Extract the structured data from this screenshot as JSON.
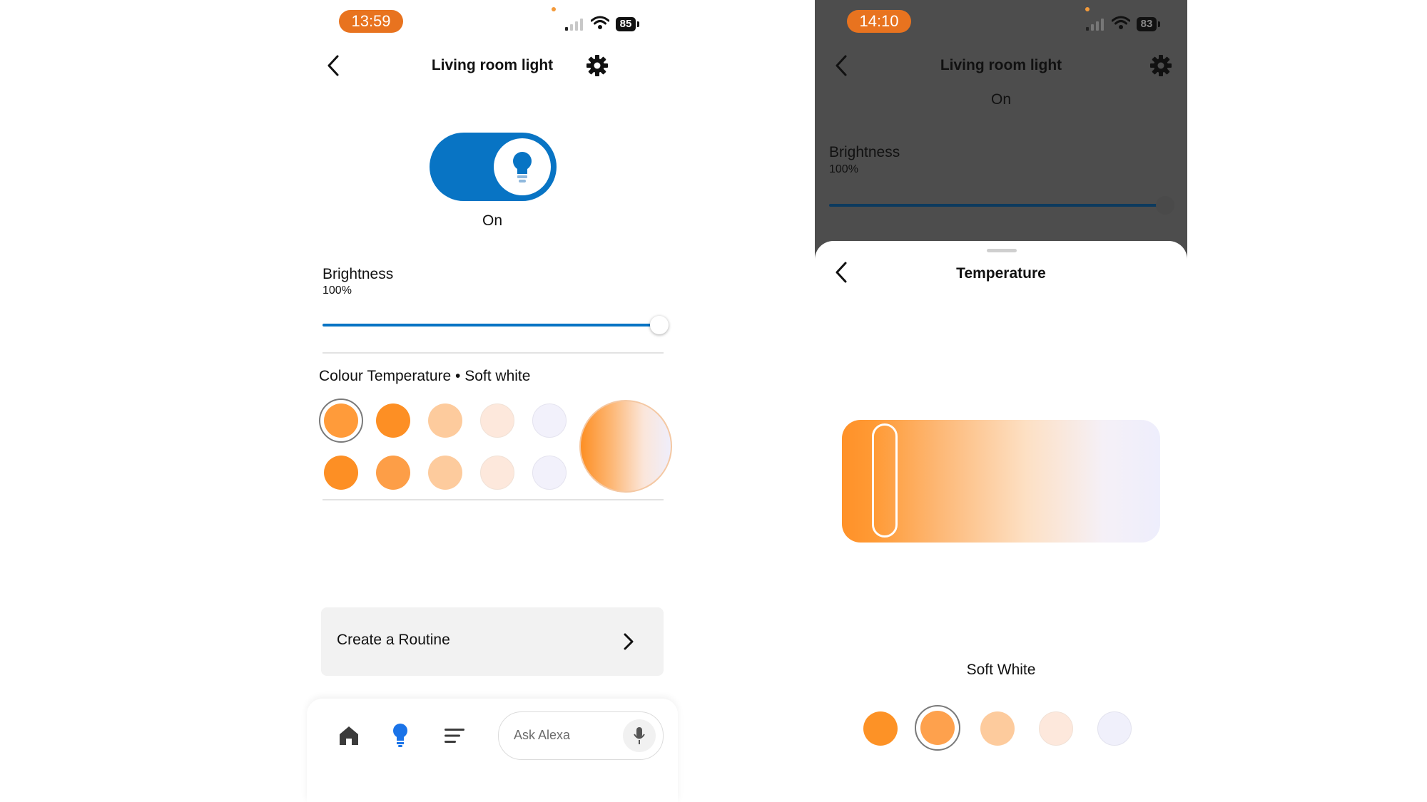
{
  "left_screen": {
    "status_bar": {
      "time": "13:59",
      "battery": "85"
    },
    "header": {
      "title": "Living room light"
    },
    "power": {
      "state_label": "On"
    },
    "brightness": {
      "label": "Brightness",
      "value": "100%",
      "level_percent": 100
    },
    "colour_temperature": {
      "label": "Colour Temperature • Soft white",
      "swatches_row1": [
        "#ff9b3a",
        "#fd8f24",
        "#fdcb9d",
        "#fde8dc",
        "#f2f1fb"
      ],
      "swatches_row2": [
        "#fd8f24",
        "#fd9e47",
        "#fdcb9d",
        "#fde8dc",
        "#f2f1fb"
      ],
      "selected_index": 0
    },
    "routine": {
      "label": "Create a Routine"
    },
    "bottom_nav": {
      "ask_placeholder": "Ask Alexa"
    },
    "colors": {
      "accent": "#0874c4",
      "time_pill": "#e8731f"
    }
  },
  "right_screen": {
    "status_bar": {
      "time": "14:10",
      "battery": "83"
    },
    "header": {
      "title": "Living room light",
      "state_label": "On"
    },
    "brightness": {
      "label": "Brightness",
      "value": "100%",
      "level_percent": 100
    },
    "sheet": {
      "title": "Temperature",
      "selection_label": "Soft White",
      "swatches": [
        "#fd9226",
        "#fea14d",
        "#fdcb9d",
        "#fde8dc",
        "#f0f0fb"
      ],
      "selected_index": 1
    },
    "colors": {
      "accent": "#0c3a5e",
      "overlay": "#4d4d4d"
    }
  }
}
